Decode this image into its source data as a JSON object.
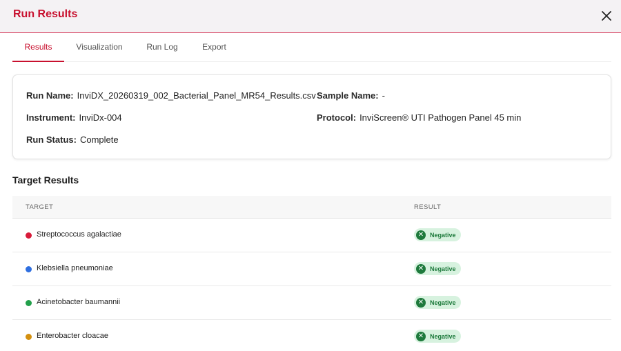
{
  "header": {
    "title": "Run Results",
    "close_icon": "close-icon"
  },
  "tabs": [
    {
      "label": "Results",
      "active": true
    },
    {
      "label": "Visualization",
      "active": false
    },
    {
      "label": "Run Log",
      "active": false
    },
    {
      "label": "Export",
      "active": false
    }
  ],
  "run_info": {
    "run_name_label": "Run Name:",
    "run_name": "InviDX_20260319_002_Bacterial_Panel_MR54_Results.csv",
    "sample_name_label": "Sample Name:",
    "sample_name": "-",
    "instrument_label": "Instrument:",
    "instrument": "InviDx-004",
    "protocol_label": "Protocol:",
    "protocol": "InviScreen® UTI Pathogen Panel 45 min",
    "run_status_label": "Run Status:",
    "run_status": "Complete"
  },
  "target_results": {
    "title": "Target Results",
    "columns": [
      "TARGET",
      "RESULT"
    ],
    "rows": [
      {
        "target": "Streptococcus agalactiae",
        "color": "#d81b3a",
        "result": "Negative",
        "result_icon": "x-circle-icon"
      },
      {
        "target": "Klebsiella pneumoniae",
        "color": "#2f6fe0",
        "result": "Negative",
        "result_icon": "x-circle-icon"
      },
      {
        "target": "Acinetobacter baumannii",
        "color": "#22a04b",
        "result": "Negative",
        "result_icon": "x-circle-icon"
      },
      {
        "target": "Enterobacter cloacae",
        "color": "#d4900f",
        "result": "Negative",
        "result_icon": "x-circle-icon"
      }
    ]
  },
  "colors": {
    "accent": "#c8102e",
    "negative_badge_bg": "#d7f2df",
    "negative_badge_fg": "#1e7a3c"
  }
}
